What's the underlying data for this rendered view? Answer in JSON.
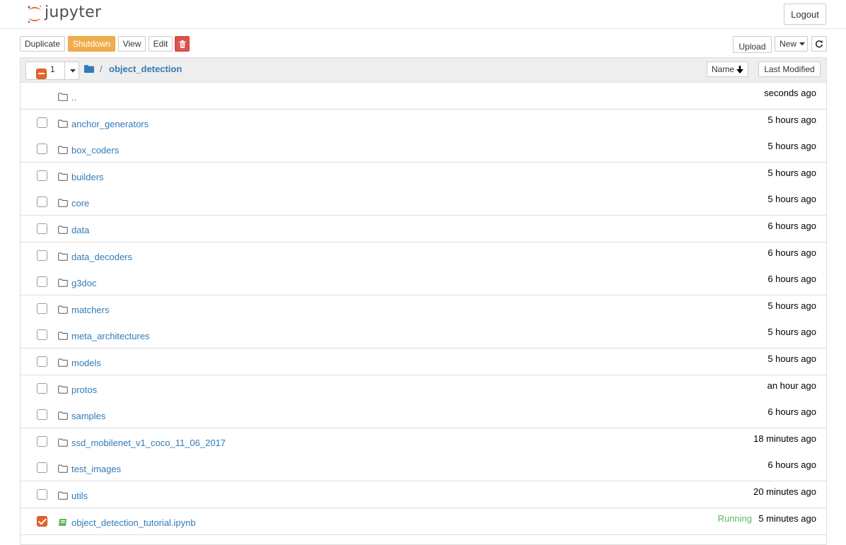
{
  "app": {
    "logo_text": "jupyter"
  },
  "header": {
    "logout_label": "Logout"
  },
  "toolbar": {
    "duplicate_label": "Duplicate",
    "shutdown_label": "Shutdown",
    "view_label": "View",
    "edit_label": "Edit",
    "upload_label": "Upload",
    "new_label": "New"
  },
  "list_header": {
    "selected_count": "1",
    "path_separator": "/",
    "current_dir": "object_detection",
    "sort_name_label": "Name",
    "sort_modified_label": "Last Modified"
  },
  "rows": [
    {
      "name": "..",
      "modified": "seconds ago",
      "type": "parent"
    },
    {
      "name": "anchor_generators",
      "modified": "5 hours ago",
      "type": "folder"
    },
    {
      "name": "box_coders",
      "modified": "5 hours ago",
      "type": "folder"
    },
    {
      "name": "builders",
      "modified": "5 hours ago",
      "type": "folder"
    },
    {
      "name": "core",
      "modified": "5 hours ago",
      "type": "folder"
    },
    {
      "name": "data",
      "modified": "6 hours ago",
      "type": "folder"
    },
    {
      "name": "data_decoders",
      "modified": "6 hours ago",
      "type": "folder"
    },
    {
      "name": "g3doc",
      "modified": "6 hours ago",
      "type": "folder"
    },
    {
      "name": "matchers",
      "modified": "5 hours ago",
      "type": "folder"
    },
    {
      "name": "meta_architectures",
      "modified": "5 hours ago",
      "type": "folder"
    },
    {
      "name": "models",
      "modified": "5 hours ago",
      "type": "folder"
    },
    {
      "name": "protos",
      "modified": "an hour ago",
      "type": "folder"
    },
    {
      "name": "samples",
      "modified": "6 hours ago",
      "type": "folder"
    },
    {
      "name": "ssd_mobilenet_v1_coco_11_06_2017",
      "modified": "18 minutes ago",
      "type": "folder"
    },
    {
      "name": "test_images",
      "modified": "6 hours ago",
      "type": "folder"
    },
    {
      "name": "utils",
      "modified": "20 minutes ago",
      "type": "folder"
    },
    {
      "name": "object_detection_tutorial.ipynb",
      "modified": "5 minutes ago",
      "type": "notebook",
      "status": "Running",
      "checked": true
    }
  ],
  "icons": {
    "logo": "jupyter-logo-icon",
    "delete": "trash-icon",
    "new_caret": "caret-down-icon",
    "refresh": "refresh-icon",
    "folder": "folder-icon",
    "notebook": "notebook-icon",
    "sort": "arrow-down-icon"
  },
  "colors": {
    "brand_orange": "#f37626",
    "link": "#337ab7",
    "running": "#5cb85c",
    "shutdown": "#f0ad4e",
    "delete": "#d9534f"
  }
}
